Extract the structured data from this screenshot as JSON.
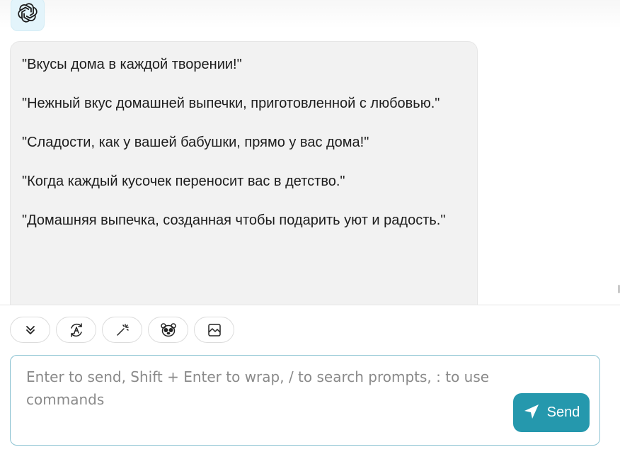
{
  "messages": [
    {
      "role": "assistant",
      "avatar_icon": "openai-logo-icon",
      "paragraphs": [
        "\"Вкусы дома в каждой творении!\"",
        "\"Нежный вкус домашней выпечки, приготовленной с любовью.\"",
        "\"Сладости, как у вашей бабушки, прямо у вас дома!\"",
        "\"Когда каждый кусочек переносит вас в детство.\"",
        "\"Домашняя выпечка, созданная чтобы подарить уют и радость.\""
      ]
    }
  ],
  "toolbar": {
    "buttons": [
      {
        "icon": "chevrons-down-icon"
      },
      {
        "icon": "translate-icon"
      },
      {
        "icon": "magic-wand-icon"
      },
      {
        "icon": "mask-icon"
      },
      {
        "icon": "image-icon"
      }
    ]
  },
  "input": {
    "placeholder": "Enter to send, Shift + Enter to wrap, / to search prompts, : to use commands",
    "value": ""
  },
  "send_button": {
    "label": "Send",
    "icon": "send-arrow-icon"
  },
  "colors": {
    "accent": "#2598ad",
    "input_border": "#8cc3d2",
    "message_bg": "#f2f2f2",
    "avatar_bg": "#e3f4fb"
  }
}
